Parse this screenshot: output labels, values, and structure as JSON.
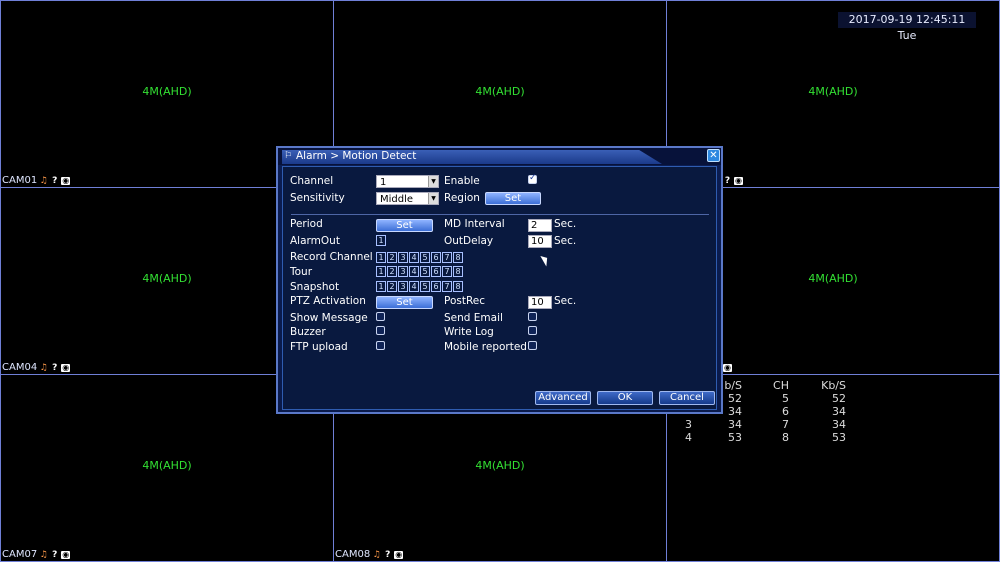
{
  "datetime": "2017-09-19 12:45:11 Tue",
  "cameras": [
    {
      "label": "CAM01",
      "resolution": "4M(AHD)"
    },
    {
      "label": "",
      "resolution": "4M(AHD)"
    },
    {
      "label": "",
      "resolution": "4M(AHD)"
    },
    {
      "label": "CAM04",
      "resolution": "4M(AHD)"
    },
    {
      "label": "",
      "resolution": ""
    },
    {
      "label": "",
      "resolution": "4M(AHD)"
    },
    {
      "label": "CAM07",
      "resolution": "4M(AHD)"
    },
    {
      "label": "CAM08",
      "resolution": "4M(AHD)"
    },
    {
      "label": "",
      "resolution": ""
    }
  ],
  "stats": {
    "headers": [
      "",
      "b/S",
      "CH",
      "Kb/S"
    ],
    "rows": [
      [
        "",
        "52",
        "5",
        "52"
      ],
      [
        "",
        "34",
        "6",
        "34"
      ],
      [
        "3",
        "34",
        "7",
        "34"
      ],
      [
        "4",
        "53",
        "8",
        "53"
      ]
    ]
  },
  "dialog": {
    "title": "Alarm > Motion Detect",
    "close_icon": "close-icon",
    "channel_label": "Channel",
    "channel_value": "1",
    "enable_label": "Enable",
    "enable_checked": true,
    "sensitivity_label": "Sensitivity",
    "sensitivity_value": "Middle",
    "region_label": "Region",
    "set_label": "Set",
    "period_label": "Period",
    "md_interval_label": "MD Interval",
    "md_interval_value": "2",
    "sec_label": "Sec.",
    "alarmout_label": "AlarmOut",
    "alarmout_value": "1",
    "outdelay_label": "OutDelay",
    "outdelay_value": "10",
    "record_channel_label": "Record Channel",
    "tour_label": "Tour",
    "snapshot_label": "Snapshot",
    "channels": [
      "1",
      "2",
      "3",
      "4",
      "5",
      "6",
      "7",
      "8"
    ],
    "ptz_label": "PTZ Activation",
    "postrec_label": "PostRec",
    "postrec_value": "10",
    "show_message_label": "Show Message",
    "send_email_label": "Send Email",
    "buzzer_label": "Buzzer",
    "write_log_label": "Write Log",
    "ftp_label": "FTP upload",
    "mobile_label": "Mobile reported",
    "advanced_label": "Advanced",
    "ok_label": "OK",
    "cancel_label": "Cancel"
  }
}
